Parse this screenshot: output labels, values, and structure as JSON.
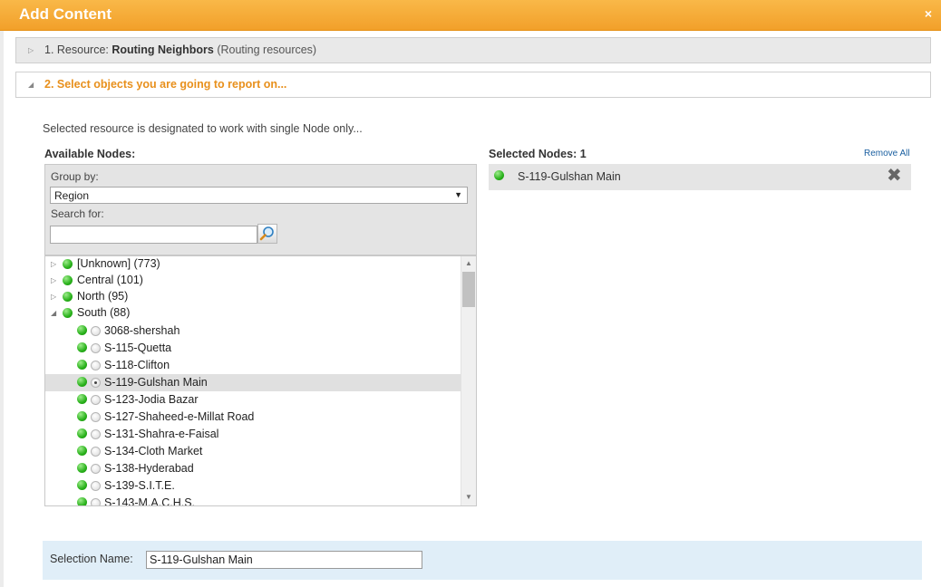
{
  "dialog": {
    "title": "Add Content",
    "close_glyph": "×",
    "accent_color": "#f2a02a"
  },
  "step1": {
    "prefix": "1. Resource: ",
    "resource_name": "Routing Neighbors",
    "resource_type": "(Routing resources)",
    "state": "collapsed"
  },
  "step2": {
    "label": "2. Select objects you are going to report on...",
    "state": "expanded"
  },
  "info_text": "Selected resource is designated to work with single Node only...",
  "available": {
    "label": "Available Nodes:",
    "group_by_label": "Group by:",
    "group_by_value": "Region",
    "search_label": "Search for:",
    "search_value": "",
    "search_icon": "magnifier-icon"
  },
  "tree": {
    "groups": [
      {
        "label": "[Unknown] (773)",
        "expanded": false,
        "status": "up"
      },
      {
        "label": "Central (101)",
        "expanded": false,
        "status": "up"
      },
      {
        "label": "North (95)",
        "expanded": false,
        "status": "up"
      },
      {
        "label": "South (88)",
        "expanded": true,
        "status": "up"
      }
    ],
    "nodes": [
      {
        "label": "3068-shershah",
        "selected": false,
        "status": "up"
      },
      {
        "label": "S-115-Quetta",
        "selected": false,
        "status": "up"
      },
      {
        "label": "S-118-Clifton",
        "selected": false,
        "status": "up"
      },
      {
        "label": "S-119-Gulshan Main",
        "selected": true,
        "status": "up"
      },
      {
        "label": "S-123-Jodia Bazar",
        "selected": false,
        "status": "up"
      },
      {
        "label": "S-127-Shaheed-e-Millat Road",
        "selected": false,
        "status": "up"
      },
      {
        "label": "S-131-Shahra-e-Faisal",
        "selected": false,
        "status": "up"
      },
      {
        "label": "S-134-Cloth Market",
        "selected": false,
        "status": "up"
      },
      {
        "label": "S-138-Hyderabad",
        "selected": false,
        "status": "up"
      },
      {
        "label": "S-139-S.I.T.E.",
        "selected": false,
        "status": "up"
      },
      {
        "label": "S-143-M.A.C.H.S.",
        "selected": false,
        "status": "up"
      }
    ]
  },
  "selected": {
    "label": "Selected Nodes: 1",
    "remove_all_label": "Remove All",
    "items": [
      {
        "label": "S-119-Gulshan Main",
        "status": "up"
      }
    ],
    "remove_glyph": "✖"
  },
  "selection_name": {
    "label": "Selection Name:",
    "value": "S-119-Gulshan Main"
  },
  "colors": {
    "status_up": "#29b11b",
    "link": "#1a5fa0",
    "step_active": "#e8901c",
    "selection_box": "#e0eef8"
  }
}
